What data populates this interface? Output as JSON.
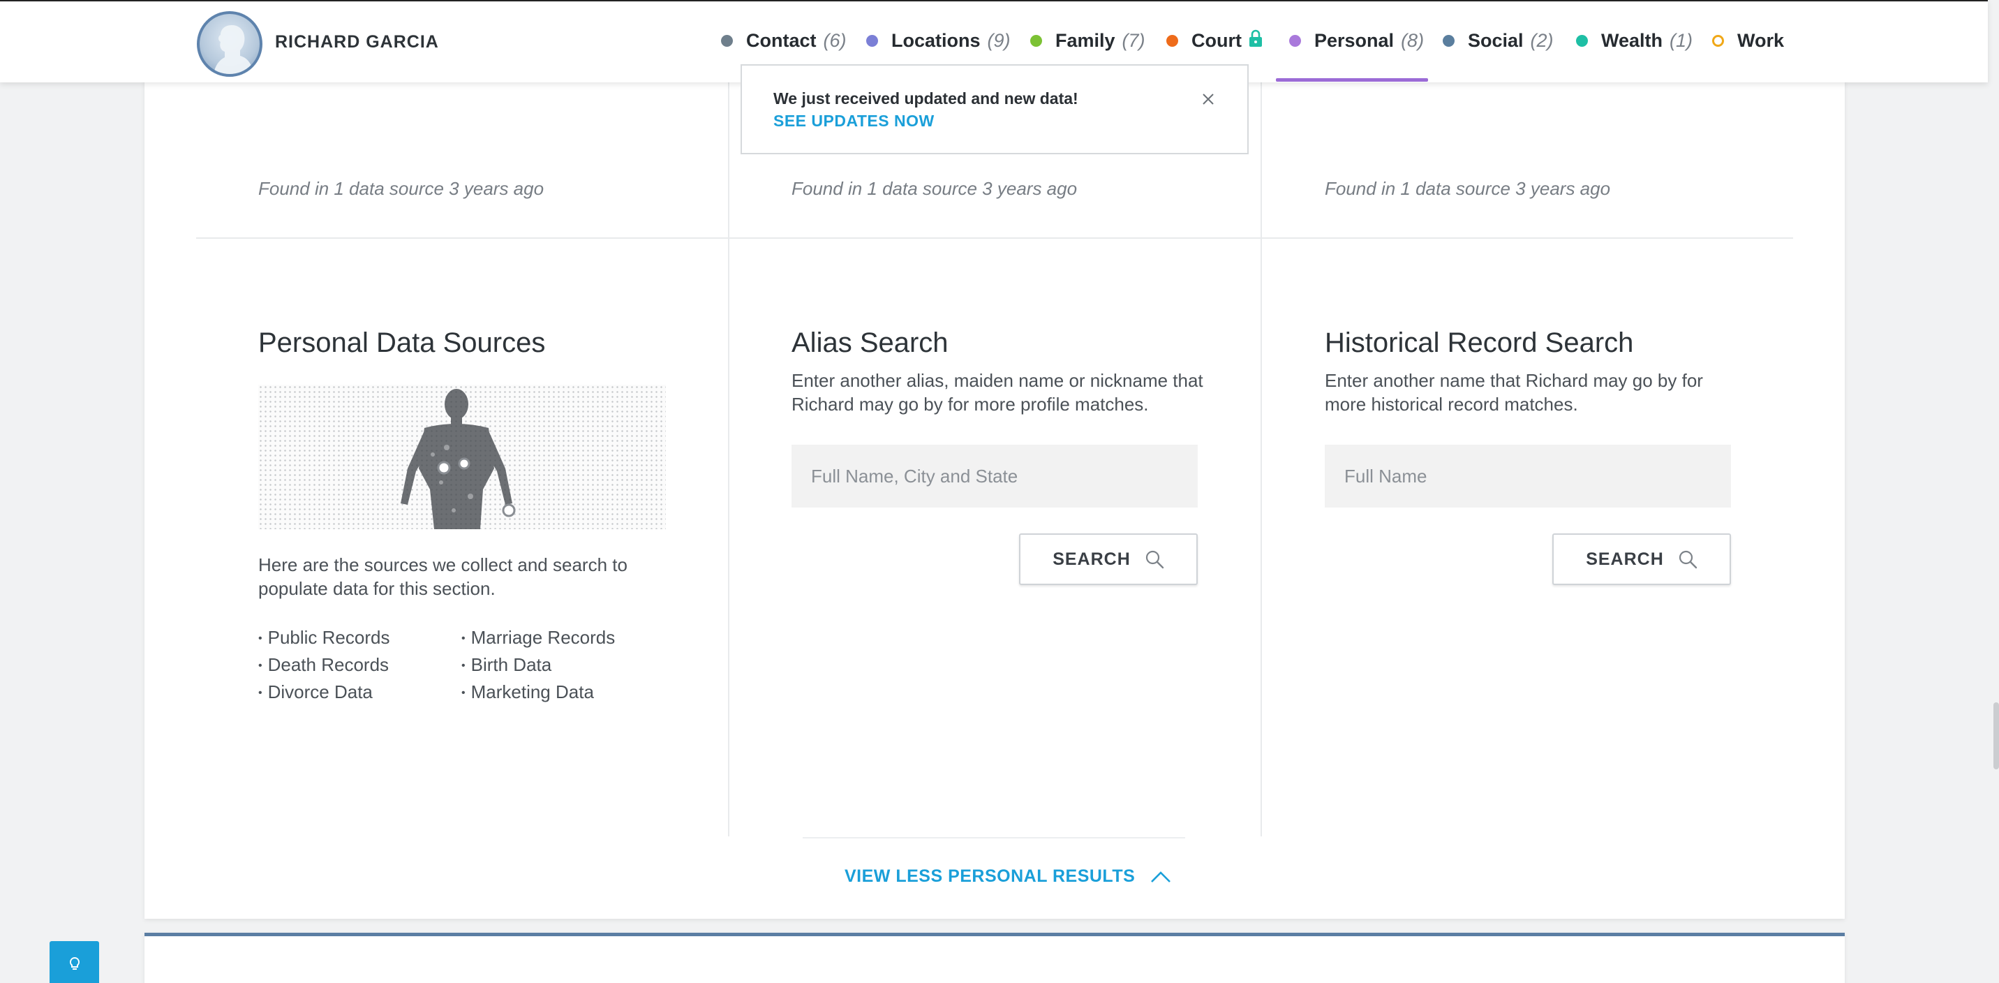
{
  "header": {
    "name": "RICHARD GARCIA",
    "nav": [
      {
        "label": "Contact",
        "count": "(6)",
        "color": "#6f7f8c"
      },
      {
        "label": "Locations",
        "count": "(9)",
        "color": "#7b7fd6"
      },
      {
        "label": "Family",
        "count": "(7)",
        "color": "#7cc234"
      },
      {
        "label": "Court",
        "count": "",
        "color": "#ee6b1a",
        "locked": true
      },
      {
        "label": "Personal",
        "count": "(8)",
        "color": "#a979db",
        "active": true
      },
      {
        "label": "Social",
        "count": "(2)",
        "color": "#5a7e9e"
      },
      {
        "label": "Wealth",
        "count": "(1)",
        "color": "#1ebfa5"
      },
      {
        "label": "Work",
        "count": "",
        "color": "#f0a818",
        "hollow": true
      }
    ]
  },
  "notification": {
    "message": "We just received updated and new data!",
    "link": "SEE UPDATES NOW"
  },
  "found_text": [
    "Found in 1 data source 3 years ago",
    "Found in 1 data source 3 years ago",
    "Found in 1 data source 3 years ago"
  ],
  "sources": {
    "title": "Personal Data Sources",
    "description": "Here are the sources we collect and search to populate data for this section.",
    "list_left": [
      "Public Records",
      "Death Records",
      "Divorce Data"
    ],
    "list_right": [
      "Marriage Records",
      "Birth Data",
      "Marketing Data"
    ]
  },
  "alias": {
    "title": "Alias Search",
    "description": "Enter another alias, maiden name or nickname that Richard may go by for more profile matches.",
    "placeholder": "Full Name, City and State",
    "button": "SEARCH"
  },
  "historical": {
    "title": "Historical Record Search",
    "description": "Enter another name that Richard may go by for more historical record matches.",
    "placeholder": "Full Name",
    "button": "SEARCH"
  },
  "view_less": "VIEW LESS PERSONAL RESULTS",
  "colors": {
    "accent": "#1a9fd9",
    "personal": "#9b6bd6"
  }
}
